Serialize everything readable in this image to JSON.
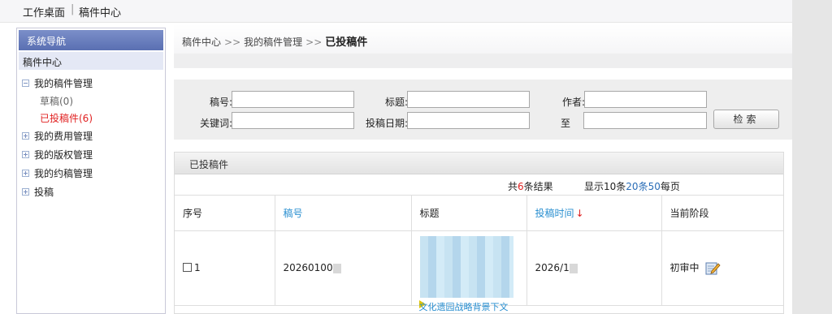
{
  "topbar": {
    "tab1": "工作桌面",
    "separator": "|",
    "tab2": "稿件中心"
  },
  "sidebar": {
    "header": "系统导航",
    "section": "稿件中心",
    "items": [
      {
        "label": "我的稿件管理",
        "expanded": true
      },
      {
        "label": "草稿(0)",
        "child": true
      },
      {
        "label": "已投稿件(6)",
        "child": true,
        "active": true
      },
      {
        "label": "我的费用管理",
        "expanded": false
      },
      {
        "label": "我的版权管理",
        "expanded": false
      },
      {
        "label": "我的约稿管理",
        "expanded": false
      },
      {
        "label": "投稿",
        "expanded": false
      }
    ]
  },
  "breadcrumb": {
    "item1": "稿件中心",
    "arrow": ">>",
    "item2": "我的稿件管理",
    "current": "已投稿件"
  },
  "search": {
    "id_label": "稿号:",
    "id_value": "",
    "title_label": "标题:",
    "title_value": "",
    "author_label": "作者:",
    "author_value": "",
    "keyword_label": "关键词:",
    "keyword_value": "",
    "date_label": "投稿日期:",
    "date_from": "",
    "to_label": "至",
    "date_to": "",
    "button": "检索"
  },
  "list": {
    "title": "已投稿件",
    "total_prefix": "共",
    "total_count": "6",
    "total_suffix": "条结果",
    "page_prefix": "显示",
    "opt1": "10条",
    "opt2": "20条",
    "opt3": "50",
    "page_suffix": "每页",
    "columns": [
      "序号",
      "稿号",
      "标题",
      "投稿时间",
      "当前阶段"
    ],
    "sort_arrow": "↓",
    "rows": [
      {
        "index": "1",
        "id": "20260100",
        "title_link": "文化遗园战略背景下文",
        "date": "2026/1",
        "stage": "初审中"
      }
    ]
  },
  "colors": {
    "accent": "#5a6fb2",
    "link": "#2a8fd0",
    "alert": "#e02020"
  },
  "icons": {
    "expand": "plus-box-icon",
    "collapse": "minus-box-icon",
    "edit": "edit-pencil-icon",
    "checkbox": "checkbox-icon"
  }
}
